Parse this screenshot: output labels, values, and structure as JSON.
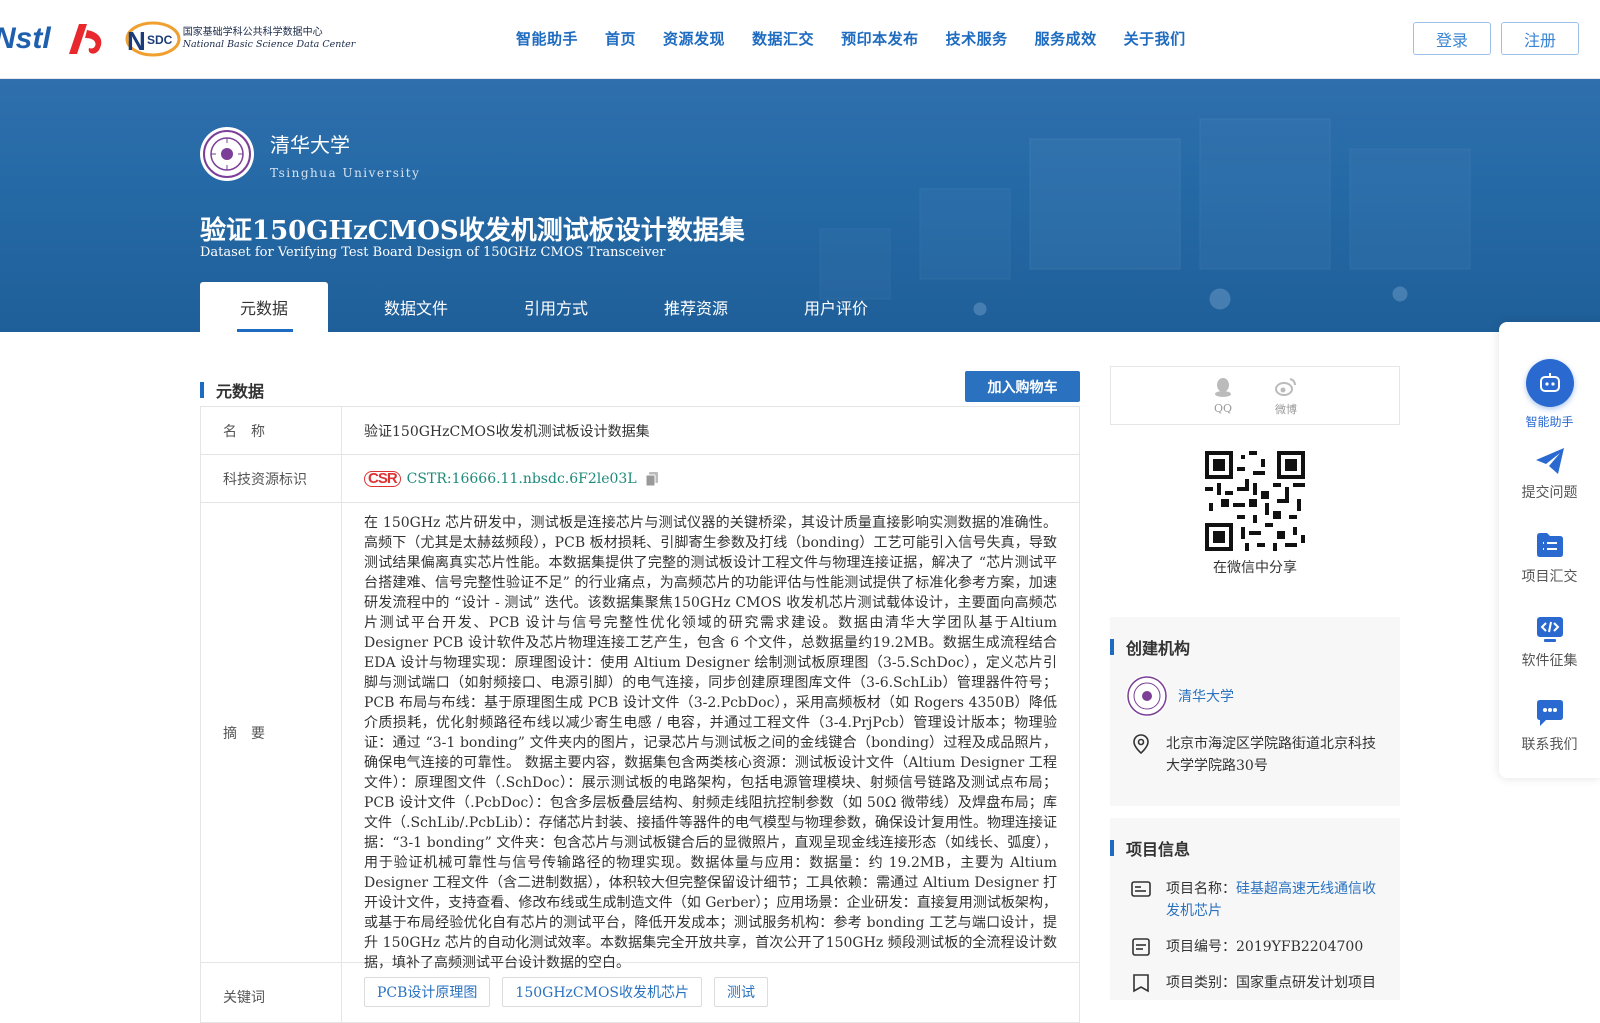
{
  "header": {
    "logos": {
      "nstl": "Nstl",
      "nsdc_mark": "NSDC",
      "nsdc_cn": "国家基础学科公共科学数据中心",
      "nsdc_en": "National Basic Science Data Center"
    },
    "nav": [
      "智能助手",
      "首页",
      "资源发现",
      "数据汇交",
      "预印本发布",
      "技术服务",
      "服务成效",
      "关于我们"
    ],
    "login": "登录",
    "register": "注册"
  },
  "hero": {
    "university_cn": "清华大学",
    "university_en": "Tsinghua University",
    "title": "验证150GHzCMOS收发机测试板设计数据集",
    "subtitle": "Dataset for Verifying Test Board Design of 150GHz CMOS Transceiver",
    "tabs": [
      "元数据",
      "数据文件",
      "引用方式",
      "推荐资源",
      "用户评价"
    ]
  },
  "metadata": {
    "section_title": "元数据",
    "cart_button": "加入购物车",
    "name_label": "名　称",
    "name_value": "验证150GHzCMOS收发机测试板设计数据集",
    "id_label": "科技资源标识",
    "id_logo": "CSR",
    "id_value": "CSTR:16666.11.nbsdc.6F2le03L",
    "abstract_label": "摘　要",
    "abstract": "在 150GHz 芯片研发中，测试板是连接芯片与测试仪器的关键桥梁，其设计质量直接影响实测数据的准确性。高频下（尤其是太赫兹频段），PCB 板材损耗、引脚寄生参数及打线（bonding）工艺可能引入信号失真，导致测试结果偏离真实芯片性能。本数据集提供了完整的测试板设计工程文件与物理连接证据，解决了 “芯片测试平台搭建难、信号完整性验证不足” 的行业痛点，为高频芯片的功能评估与性能测试提供了标准化参考方案，加速研发流程中的 “设计 - 测试” 迭代。该数据集聚焦150GHz CMOS 收发机芯片测试载体设计，主要面向高频芯片测试平台开发、PCB 设计与信号完整性优化领域的研究需求建设。数据由清华大学团队基于Altium Designer PCB 设计软件及芯片物理连接工艺产生，包含 6 个文件，总数据量约19.2MB。数据生成流程结合EDA 设计与物理实现：原理图设计：使用 Altium Designer 绘制测试板原理图（3-5.SchDoc），定义芯片引脚与测试端口（如射频接口、电源引脚）的电气连接，同步创建原理图库文件（3-6.SchLib）管理器件符号；PCB 布局与布线：基于原理图生成 PCB 设计文件（3-2.PcbDoc），采用高频板材（如 Rogers 4350B）降低介质损耗，优化射频路径布线以减少寄生电感 / 电容，并通过工程文件（3-4.PrjPcb）管理设计版本；物理验证：通过 “3-1 bonding” 文件夹内的图片，记录芯片与测试板之间的金线键合（bonding）过程及成品照片，确保电气连接的可靠性。 数据主要内容，数据集包含两类核心资源：测试板设计文件（Altium Designer 工程文件）：原理图文件（.SchDoc）：展示测试板的电路架构，包括电源管理模块、射频信号链路及测试点布局；PCB 设计文件（.PcbDoc）：包含多层板叠层结构、射频走线阻抗控制参数（如 50Ω 微带线）及焊盘布局；库文件（.SchLib/.PcbLib）：存储芯片封装、接插件等器件的电气模型与物理参数，确保设计复用性。物理连接证据：“3-1 bonding” 文件夹：包含芯片与测试板键合后的显微照片，直观呈现金线连接形态（如线长、弧度），用于验证机械可靠性与信号传输路径的物理实现。数据体量与应用：数据量：约 19.2MB，主要为 Altium Designer 工程文件（含二进制数据），体积较大但完整保留设计细节；工具依赖：需通过 Altium Designer 打开设计文件，支持查看、修改布线或生成制造文件（如 Gerber）；应用场景：企业研发：直接复用测试板架构，或基于布局经验优化自有芯片的测试平台，降低开发成本；测试服务机构：参考 bonding 工艺与端口设计，提升 150GHz 芯片的自动化测试效率。本数据集完全开放共享，首次公开了150GHz 频段测试板的全流程设计数据，填补了高频测试平台设计数据的空白。",
    "keywords_label": "关键词",
    "keywords": [
      "PCB设计原理图",
      "150GHzCMOS收发机芯片",
      "测试"
    ]
  },
  "sidebar": {
    "share_qq": "QQ",
    "share_weibo": "微博",
    "qr_caption": "在微信中分享",
    "org_title": "创建机构",
    "org_name": "清华大学",
    "org_address": "北京市海淀区学院路街道北京科技大学学院路30号",
    "project_title": "项目信息",
    "project_name_label": "项目名称：",
    "project_name": "硅基超高速无线通信收发机芯片",
    "project_no": "项目编号：2019YFB2204700",
    "project_type": "项目类别：国家重点研发计划项目"
  },
  "float_bar": {
    "assistant": "智能助手",
    "submit_issue": "提交问题",
    "project_submit": "项目汇交",
    "software": "软件征集",
    "contact": "联系我们"
  },
  "colors": {
    "primary": "#1e6bc0",
    "hero": "#256aa6",
    "link": "#2a72c0"
  }
}
